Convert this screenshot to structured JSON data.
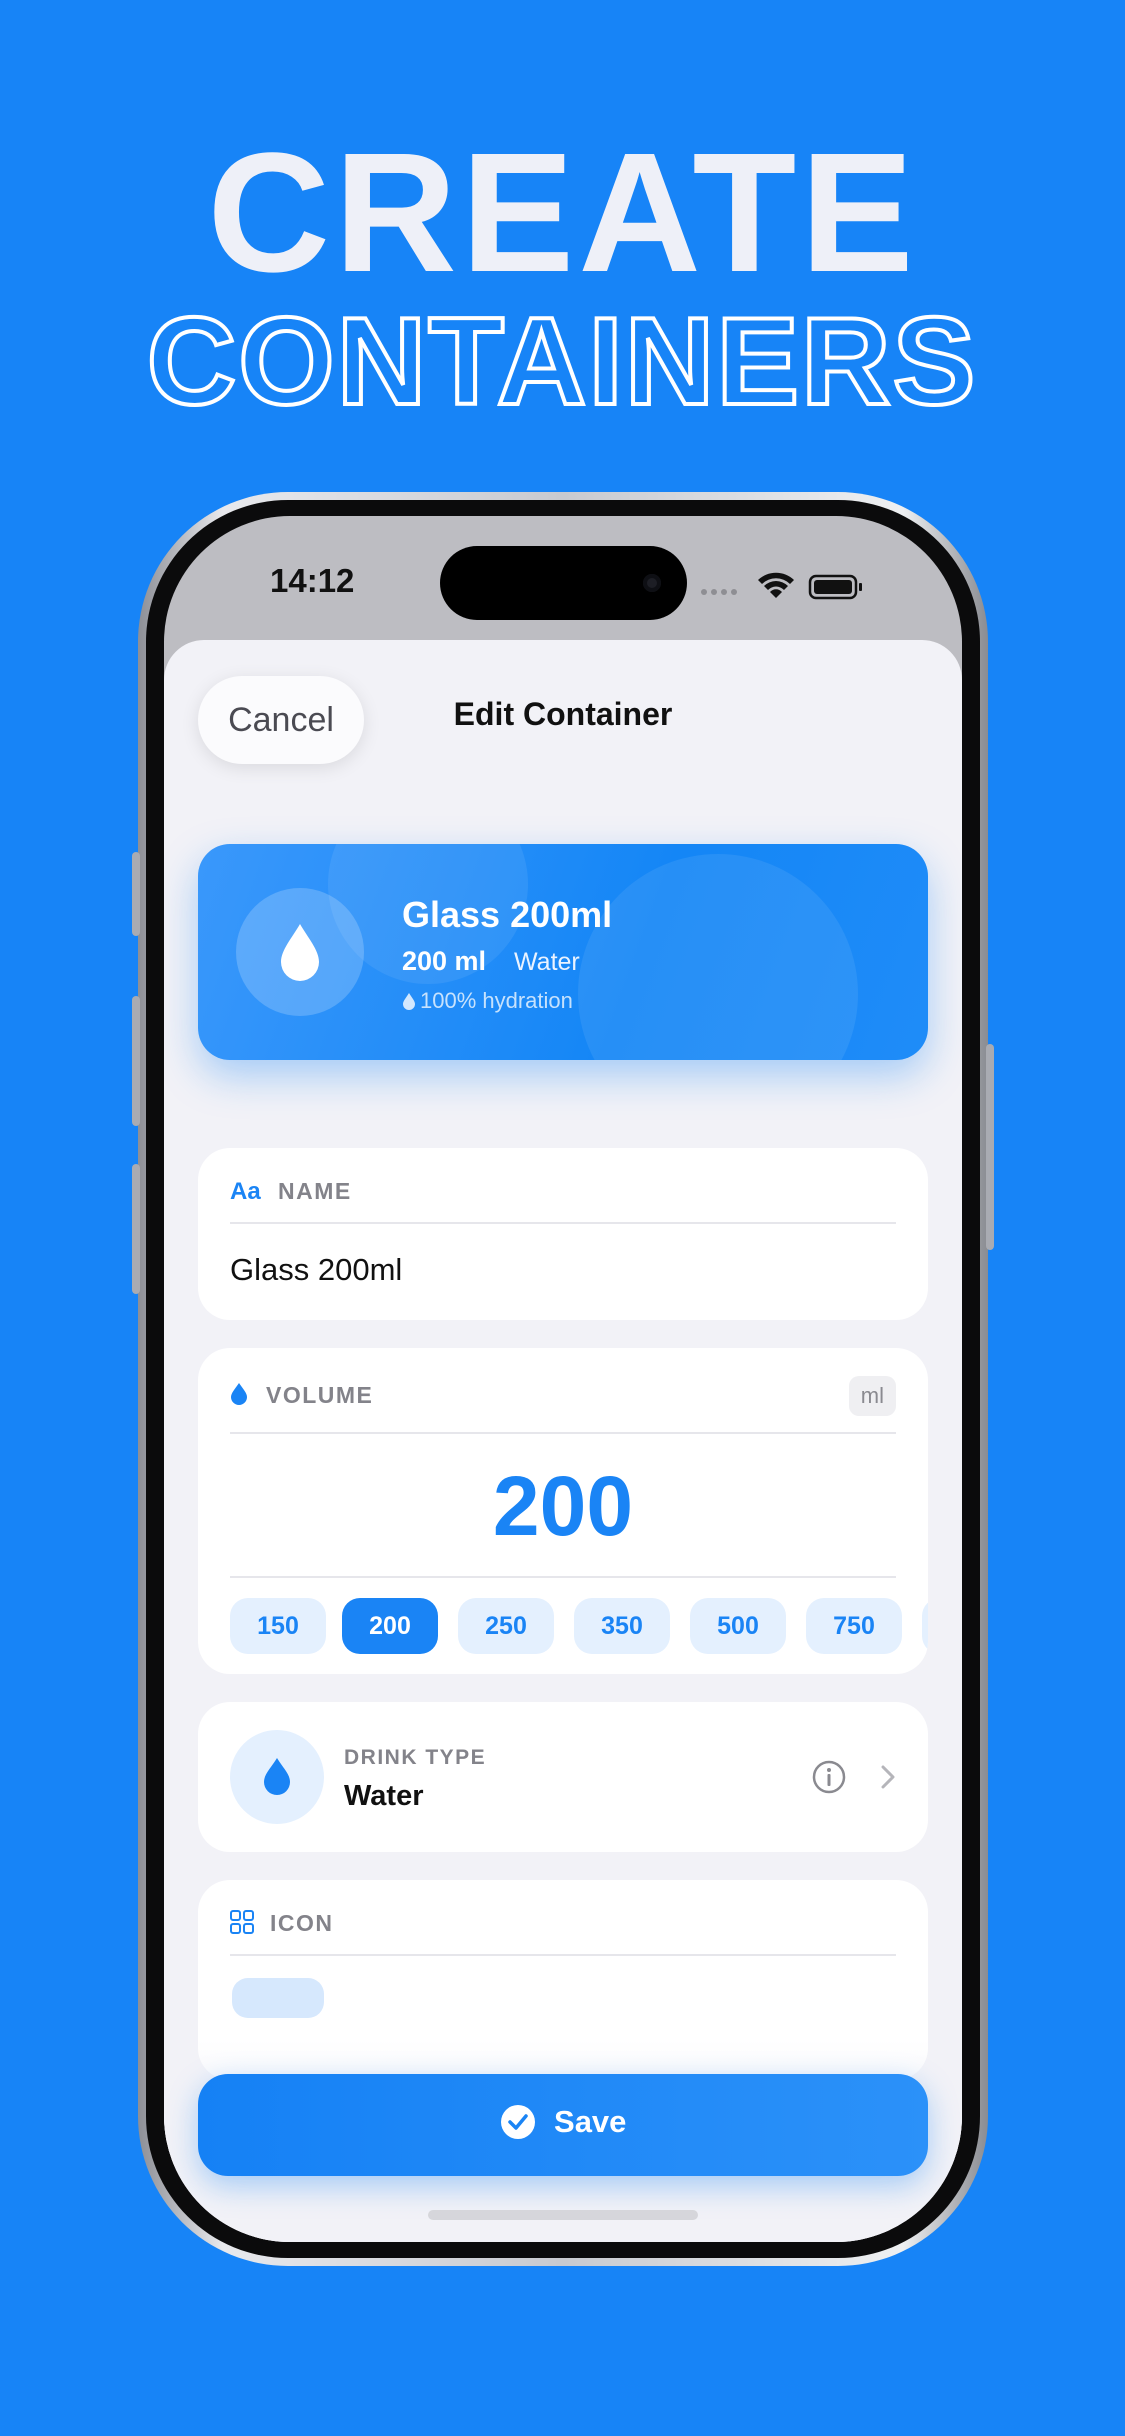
{
  "hero": {
    "title": "CREATE",
    "subtitle": "CONTAINERS"
  },
  "status_bar": {
    "time": "14:12"
  },
  "sheet": {
    "cancel_label": "Cancel",
    "title": "Edit Container"
  },
  "preview": {
    "name": "Glass 200ml",
    "volume": "200 ml",
    "drink_type": "Water",
    "hydration": "100% hydration"
  },
  "name_section": {
    "icon_text": "Aa",
    "label": "NAME",
    "value": "Glass 200ml"
  },
  "volume_section": {
    "label": "VOLUME",
    "unit": "ml",
    "value": "200",
    "presets": [
      "150",
      "200",
      "250",
      "350",
      "500",
      "750"
    ],
    "selected_preset": "200"
  },
  "drink_type_section": {
    "label": "DRINK TYPE",
    "value": "Water"
  },
  "icon_section": {
    "label": "ICON"
  },
  "save_label": "Save",
  "colors": {
    "background": "#1784f7",
    "accent": "#1a84f5",
    "sheet": "#f2f2f7"
  }
}
